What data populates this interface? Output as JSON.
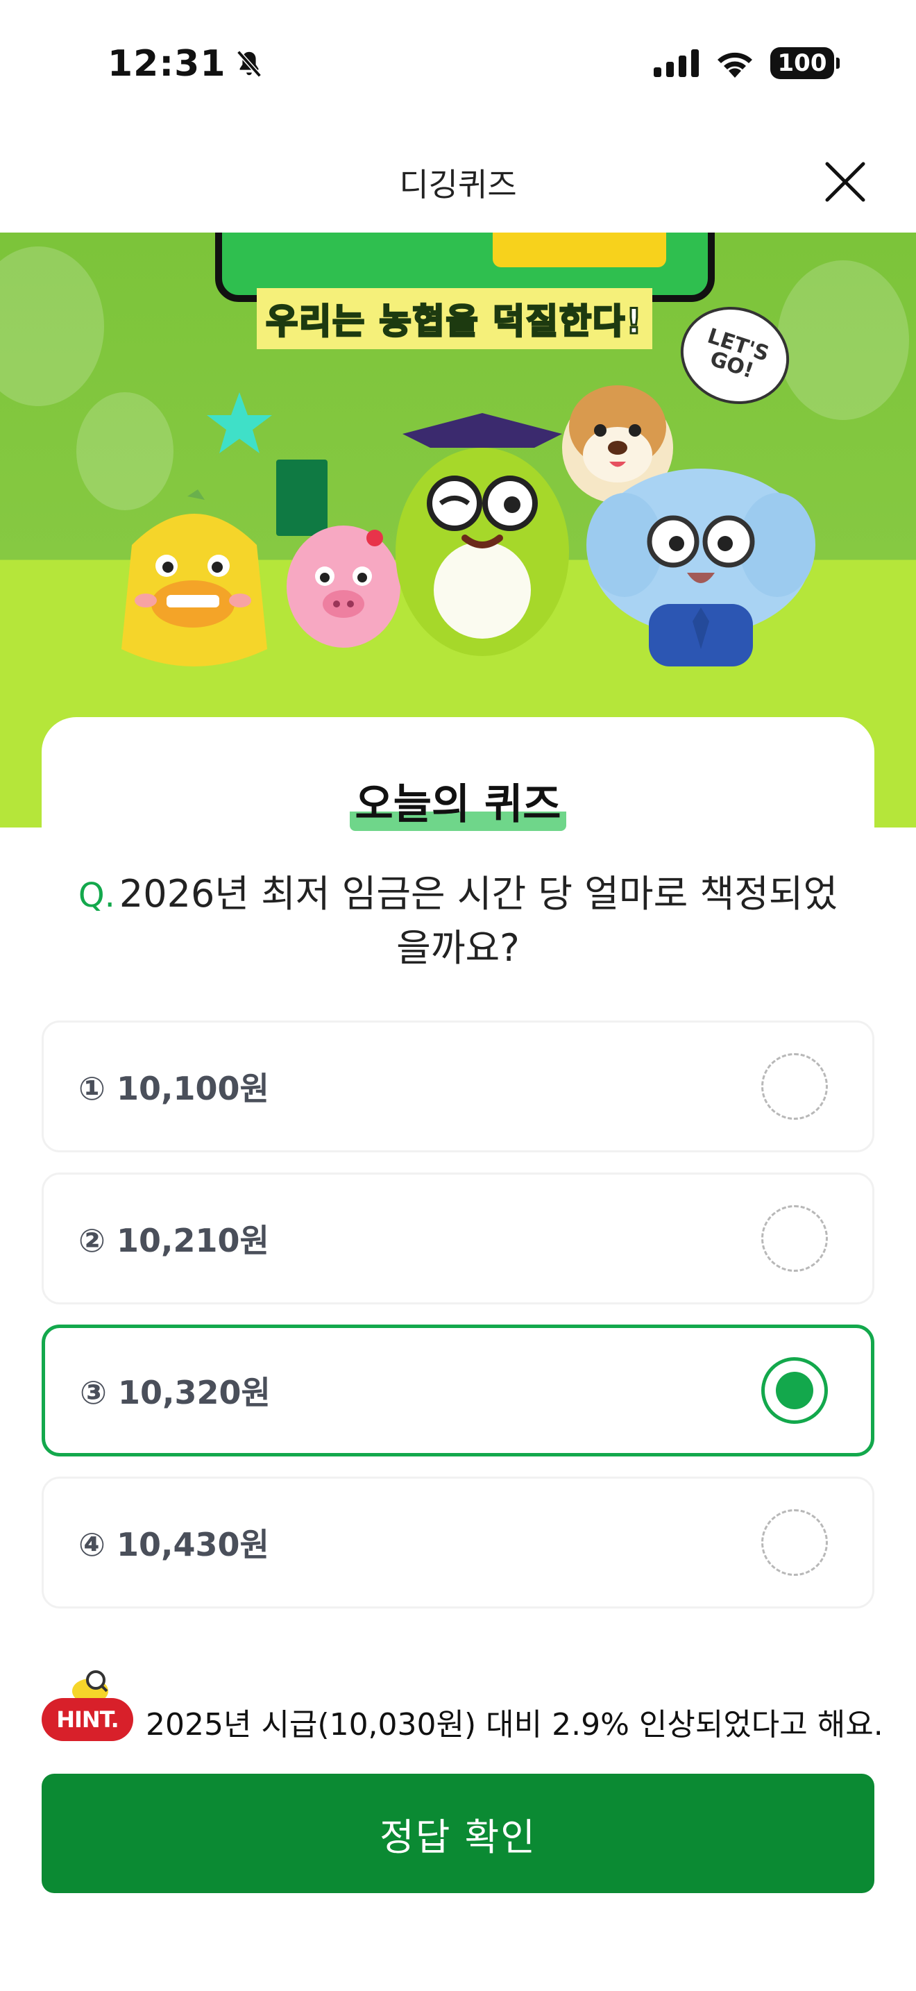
{
  "status_bar": {
    "time": "12:31",
    "battery": "100",
    "icons": [
      "bell-slash-icon",
      "cellular-signal-icon",
      "wifi-icon",
      "battery-icon"
    ]
  },
  "header": {
    "title": "디깅퀴즈",
    "close_icon": "close-icon"
  },
  "banner": {
    "slogan": "우리는 농협을 덕질한다!",
    "bubble_text": "LET'S GO!"
  },
  "quiz": {
    "heading": "오늘의 퀴즈",
    "question_prefix": "Q.",
    "question": "2026년 최저 임금은 시간 당 얼마로 책정되었을까요?",
    "options": [
      {
        "label": "① 10,100원",
        "selected": false
      },
      {
        "label": "② 10,210원",
        "selected": false
      },
      {
        "label": "③ 10,320원",
        "selected": true
      },
      {
        "label": "④ 10,430원",
        "selected": false
      }
    ],
    "selected_index": 2
  },
  "hint": {
    "badge": "HINT.",
    "text": "2025년 시급(10,030원) 대비 2.9% 인상되었다고 해요."
  },
  "submit": {
    "label": "정답 확인"
  },
  "colors": {
    "accent_green": "#13a84c",
    "button_green": "#0b8a33",
    "hint_red": "#d8202a",
    "banner_green": "#7cc43a",
    "banner_lime": "#b5e63a"
  }
}
